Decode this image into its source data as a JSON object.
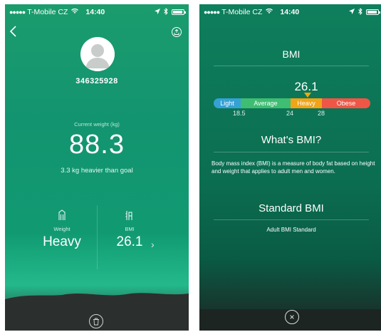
{
  "status_bar": {
    "signal": "●●●●●",
    "carrier": "T-Mobile CZ",
    "wifi": "wifi-icon",
    "time": "14:40",
    "location": "location-arrow-icon",
    "bluetooth": "bluetooth-icon",
    "battery": "battery-icon"
  },
  "profile_screen": {
    "user_id": "346325928",
    "current_weight_label": "Current weight (kg)",
    "current_weight": "88.3",
    "weight_diff": "3.3 kg heavier than goal",
    "weight_stat": {
      "label": "Weight",
      "value": "Heavy",
      "icon": "weight-body-icon"
    },
    "bmi_stat": {
      "label": "BMI",
      "value": "26.1",
      "icon": "bmi-body-icon"
    },
    "arrow": "›",
    "icons": [
      "back-chevron-icon",
      "share-icon",
      "avatar-silhouette-icon",
      "trash-icon"
    ]
  },
  "bmi_screen": {
    "title": "BMI",
    "bmi_value": "26.1",
    "scale": {
      "segments": [
        {
          "label": "Light",
          "color": "#35a2d6"
        },
        {
          "label": "Average",
          "color": "#3fbd73"
        },
        {
          "label": "Heavy",
          "color": "#f1a417"
        },
        {
          "label": "Obese",
          "color": "#ef5646"
        }
      ],
      "ticks": [
        "18.5",
        "24",
        "28"
      ]
    },
    "whats_bmi_title": "What's BMI?",
    "whats_bmi_text": "Body mass index (BMI) is a measure of body fat based on height and weight that applies to adult men and women.",
    "standard_title": "Standard BMI",
    "standard_label": "Adult BMI Standard",
    "close": "×"
  }
}
